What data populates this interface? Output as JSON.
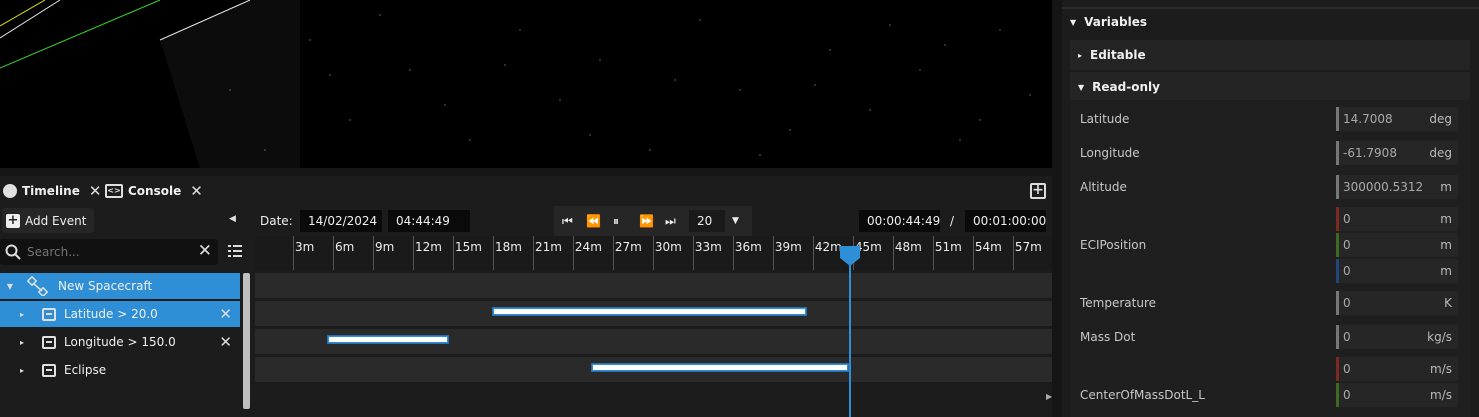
{
  "tabs": {
    "timeline_label": "Timeline",
    "console_label": "Console"
  },
  "left": {
    "add_event_label": "Add Event",
    "search_placeholder": "Search...",
    "tree": [
      {
        "label": "New Spacecraft",
        "selected": true
      },
      {
        "label": "Latitude > 20.0",
        "selected": true,
        "closable": true
      },
      {
        "label": "Longitude > 150.0",
        "selected": false,
        "closable": true
      },
      {
        "label": "Eclipse",
        "selected": false,
        "closable": false
      }
    ]
  },
  "controls": {
    "date_label": "Date:",
    "date_value": "14/02/2024",
    "time_value": "04:44:49",
    "speed_value": "20",
    "elapsed": "00:00:44:49",
    "separator": "/",
    "total": "00:01:00:00"
  },
  "ruler": {
    "ticks": [
      "3m",
      "6m",
      "9m",
      "12m",
      "15m",
      "18m",
      "21m",
      "24m",
      "27m",
      "30m",
      "33m",
      "36m",
      "39m",
      "42m",
      "45m",
      "48m",
      "51m",
      "54m",
      "57m"
    ],
    "playhead_minutes": 44.8
  },
  "tracks": [
    {
      "name": "New Spacecraft",
      "intervals": []
    },
    {
      "name": "Latitude > 20.0",
      "intervals": [
        [
          18.0,
          41.5
        ]
      ]
    },
    {
      "name": "Longitude > 150.0",
      "intervals": [
        [
          5.6,
          14.6
        ]
      ]
    },
    {
      "name": "Eclipse",
      "intervals": [
        [
          25.4,
          44.6
        ]
      ]
    }
  ],
  "right": {
    "variables_label": "Variables",
    "editable_label": "Editable",
    "readonly_label": "Read-only",
    "rows": [
      {
        "label": "Latitude",
        "value": "14.7008",
        "unit": "deg"
      },
      {
        "label": "Longitude",
        "value": "-61.7908",
        "unit": "deg"
      },
      {
        "label": "Altitude",
        "value": "300000.5312",
        "unit": "m"
      },
      {
        "label": "ECIPosition",
        "value_x": "0",
        "value_y": "0",
        "value_z": "0",
        "unit": "m"
      },
      {
        "label": "Temperature",
        "value": "0",
        "unit": "K"
      },
      {
        "label": "Mass Dot",
        "value": "0",
        "unit": "kg/s"
      },
      {
        "label": "CenterOfMassDotL_L",
        "value_x": "0",
        "value_y": "0",
        "unit": "m/s"
      }
    ]
  },
  "colors": {
    "accent": "#2e8fd6",
    "background": "#1c1c1c",
    "viewport": "#000000"
  }
}
